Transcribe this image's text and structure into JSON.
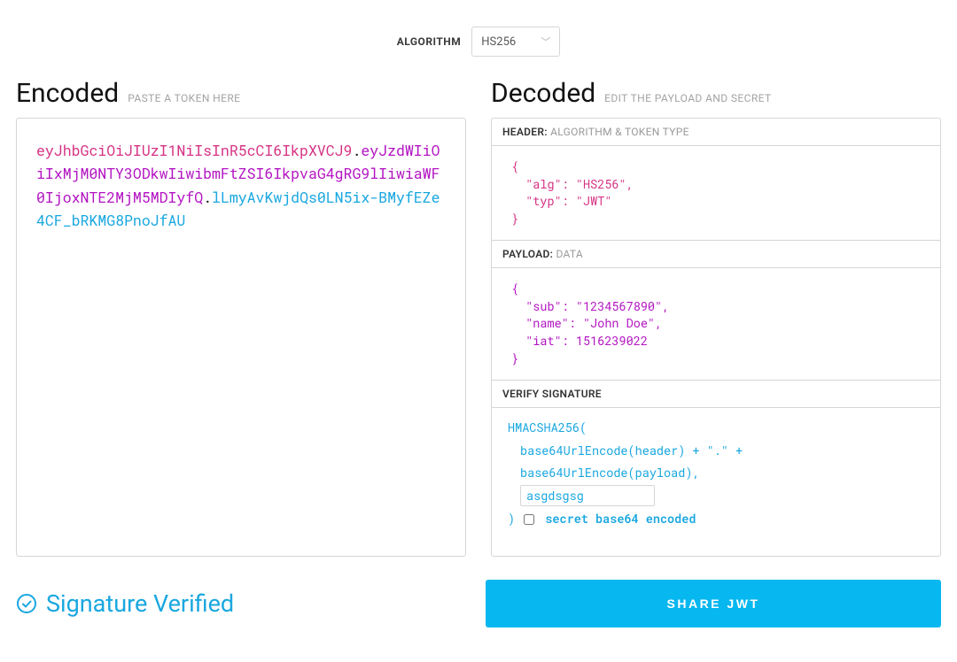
{
  "algorithm": {
    "label": "ALGORITHM",
    "selected": "HS256"
  },
  "encoded": {
    "title": "Encoded",
    "subtitle": "PASTE A TOKEN HERE",
    "token": {
      "header": "eyJhbGciOiJIUzI1NiIsInR5cCI6IkpXVCJ9",
      "payload": "eyJzdWIiOiIxMjM0NTY3ODkwIiwibmFtZSI6IkpvaG4gRG9lIiwiaWF0IjoxNTE2MjM5MDIyfQ",
      "signature": "lLmyAvKwjdQs0LN5ix-BMyfEZe4CF_bRKMG8PnoJfAU"
    }
  },
  "decoded": {
    "title": "Decoded",
    "subtitle": "EDIT THE PAYLOAD AND SECRET",
    "headerBox": {
      "label_strong": "HEADER:",
      "label_dim": "ALGORITHM & TOKEN TYPE",
      "json_text": "{\n  \"alg\": \"HS256\",\n  \"typ\": \"JWT\"\n}"
    },
    "payloadBox": {
      "label_strong": "PAYLOAD:",
      "label_dim": "DATA",
      "json_text": "{\n  \"sub\": \"1234567890\",\n  \"name\": \"John Doe\",\n  \"iat\": 1516239022\n}"
    },
    "signatureBox": {
      "label": "VERIFY SIGNATURE",
      "fn_open": "HMACSHA256(",
      "line1": "base64UrlEncode(header) + \".\" +",
      "line2": "base64UrlEncode(payload),",
      "secret_value": "asgdsgsg",
      "close_paren": ")",
      "checkbox_label": "secret base64 encoded",
      "checkbox_checked": false
    }
  },
  "footer": {
    "verify_text": "Signature Verified",
    "share_label": "SHARE JWT"
  }
}
